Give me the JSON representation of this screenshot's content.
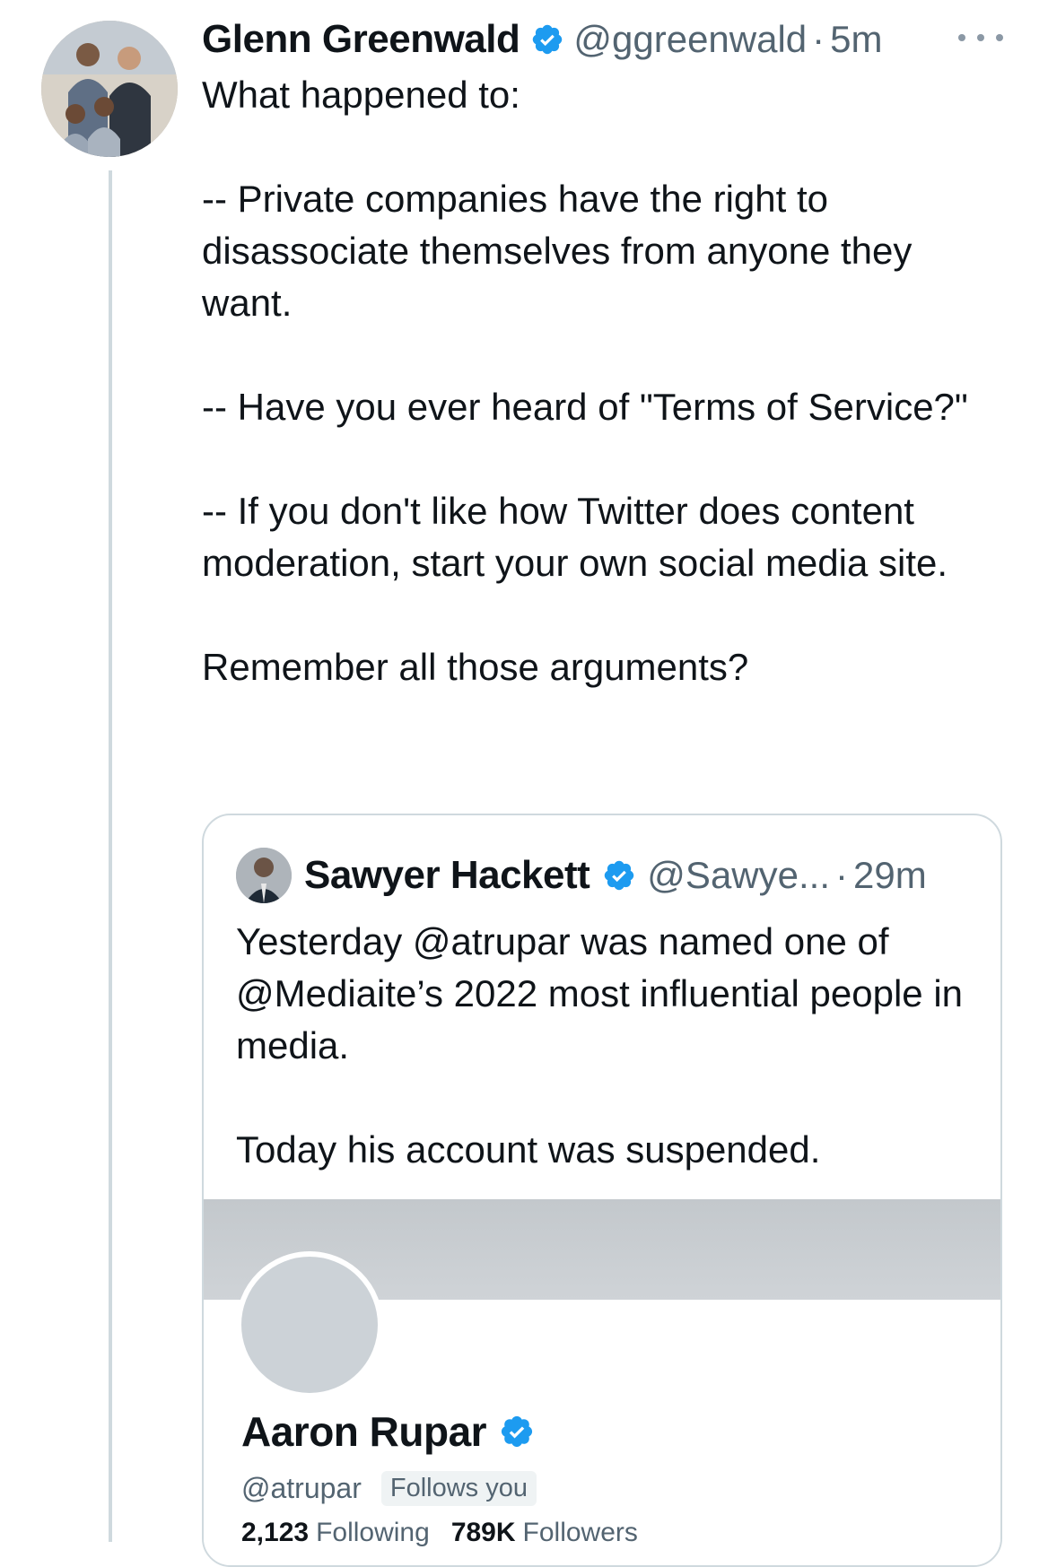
{
  "tweet": {
    "author_name": "Glenn Greenwald",
    "handle": "@ggreenwald",
    "separator": "·",
    "time": "5m",
    "paragraphs": [
      "What happened to:",
      "-- Private companies have the right to disassociate themselves from anyone they want.",
      "-- Have you ever heard of \"Terms of Service?\"",
      "-- If you don't like how Twitter does content moderation, start your own social media site.",
      "Remember all those arguments?"
    ],
    "more_icon": "ellipsis-icon",
    "verified_icon": "verified-badge-icon"
  },
  "quoted_tweet": {
    "author_name": "Sawyer Hackett",
    "handle": "@Sawye...",
    "separator": "·",
    "time": "29m",
    "paragraphs": [
      "Yesterday @atrupar was named one of @Mediaite’s 2022 most influential people in media.",
      "Today his account was suspended."
    ]
  },
  "profile_card": {
    "name": "Aaron Rupar",
    "handle": "@atrupar",
    "follows_badge": "Follows you",
    "following_count": "2,123",
    "following_label": "Following",
    "followers_count": "789K",
    "followers_label": "Followers"
  },
  "colors": {
    "verified_blue": "#1d9bf0",
    "text_primary": "#0f1419",
    "text_secondary": "#536471",
    "border": "#cfd9de"
  }
}
